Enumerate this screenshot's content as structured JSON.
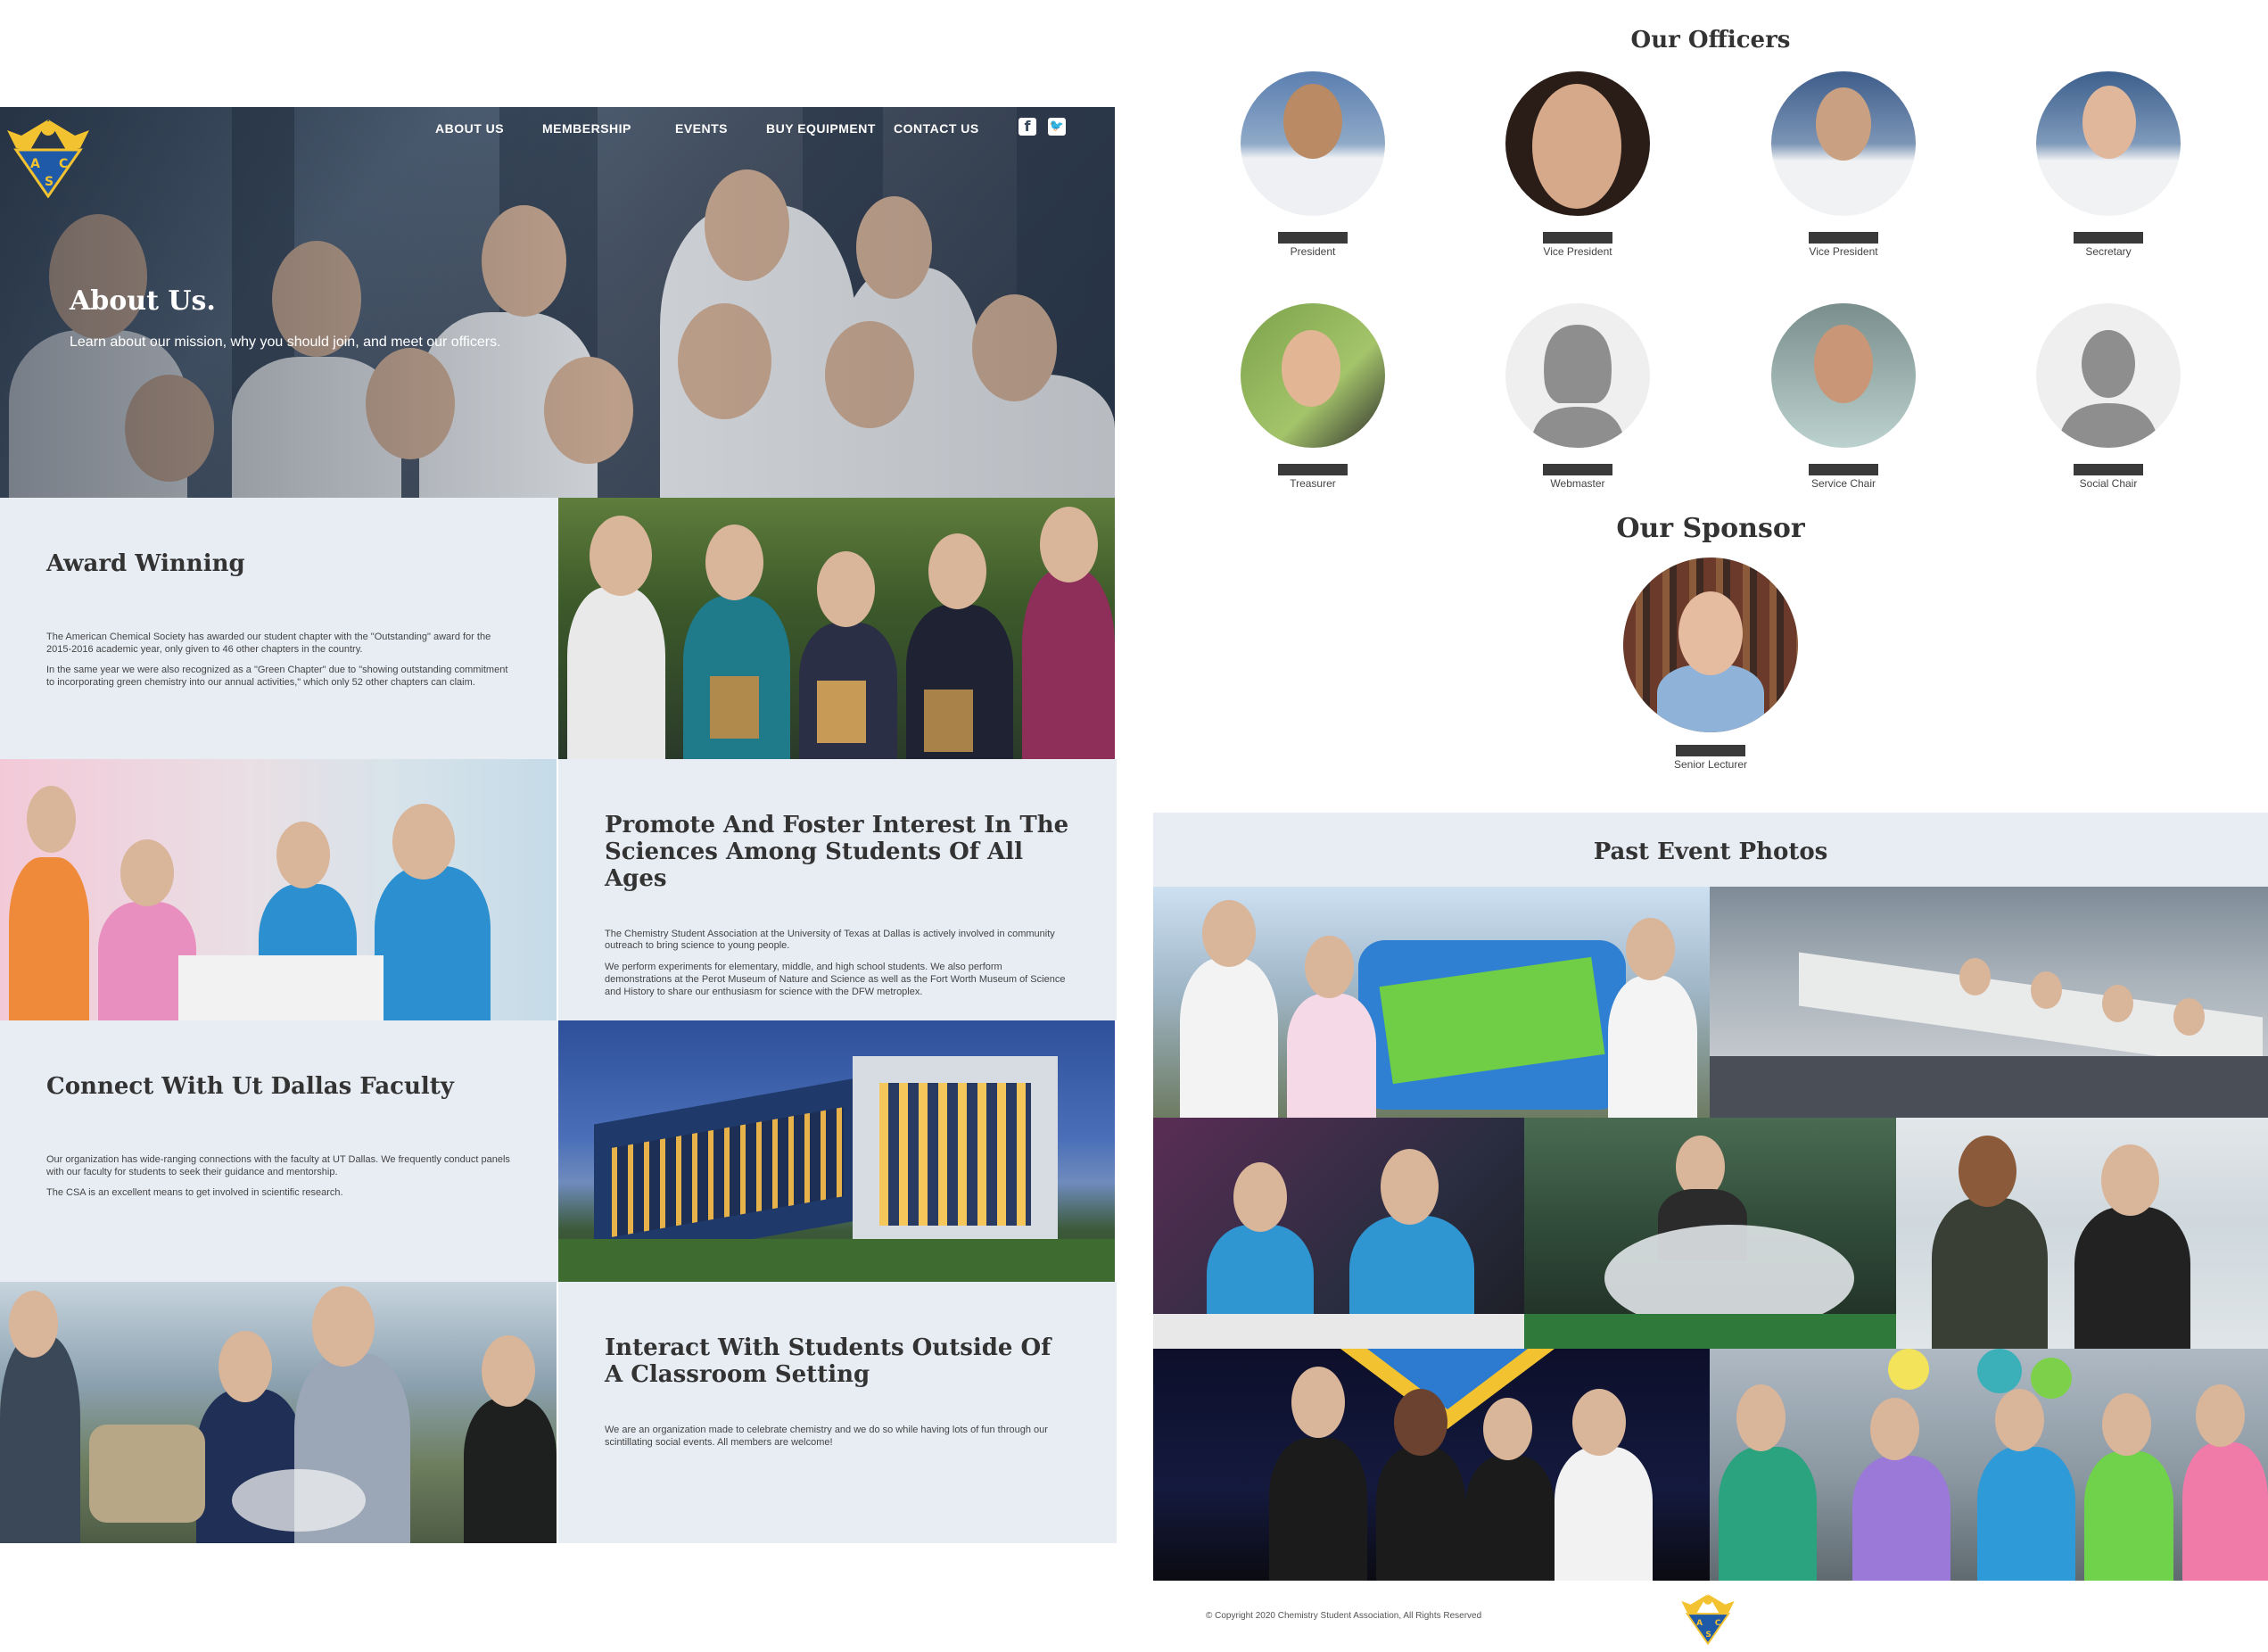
{
  "nav": {
    "items": [
      "ABOUT US",
      "MEMBERSHIP",
      "EVENTS",
      "BUY EQUIPMENT",
      "CONTACT US"
    ],
    "social": [
      "facebook-icon",
      "twitter-icon"
    ]
  },
  "logo": {
    "letters": [
      "A",
      "C",
      "S"
    ]
  },
  "hero": {
    "title": "About Us.",
    "subtitle": "Learn about our mission, why you should join, and meet our officers."
  },
  "sections": [
    {
      "title": "Award Winning",
      "paragraphs": [
        "The American Chemical Society has awarded our student chapter with the \"Outstanding\" award for the 2015-2016 academic year, only given to 46 other chapters in the country.",
        "In the same year we were also recognized as a \"Green Chapter\" due to \"showing outstanding commitment to incorporating green chemistry into our annual activities,\" which only 52 other chapters can claim."
      ]
    },
    {
      "title": "Promote And Foster Interest In The Sciences Among Students Of All Ages",
      "paragraphs": [
        "The Chemistry Student Association at the University of Texas at Dallas is actively involved in community outreach to bring science to young people.",
        "We perform experiments for elementary, middle, and high school students. We also perform demonstrations at the Perot Museum of Nature and Science as well as the Fort Worth Museum of Science and History to share our enthusiasm for science with the DFW metroplex."
      ]
    },
    {
      "title": "Connect With Ut Dallas Faculty",
      "paragraphs": [
        "Our organization has wide-ranging connections with the faculty at UT Dallas. We frequently conduct panels with our faculty for students to seek their guidance and mentorship.",
        "The CSA is an excellent means to get involved in scientific research."
      ]
    },
    {
      "title": "Interact With Students Outside Of A Classroom Setting",
      "paragraphs": [
        "We are an organization made to celebrate chemistry and we do so while having lots of fun through our scintillating social events. All members are welcome!"
      ]
    }
  ],
  "officers": {
    "title": "Our Officers",
    "roles": [
      "President",
      "Vice President",
      "Vice President",
      "Secretary",
      "Treasurer",
      "Webmaster",
      "Service Chair",
      "Social Chair"
    ]
  },
  "sponsor": {
    "title": "Our Sponsor",
    "role": "Senior Lecturer"
  },
  "events": {
    "title": "Past Event Photos"
  },
  "footer": {
    "copyright": "© Copyright 2020 Chemistry Student Association, All Rights Reserved"
  },
  "colors": {
    "panel_bg": "#e8edf4",
    "nav_text": "#ffffff",
    "logo_gold": "#f2c230",
    "logo_blue": "#1f5aa8"
  }
}
